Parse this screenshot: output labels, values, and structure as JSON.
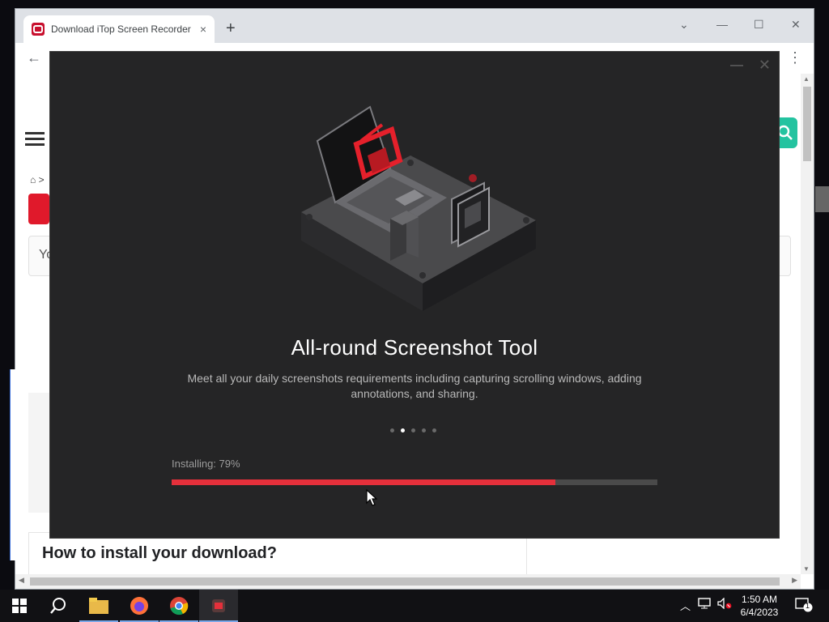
{
  "browser": {
    "tab_title": "Download iTop Screen Recorder",
    "tab_close": "×",
    "new_tab": "+",
    "back": "←",
    "menu": "⋮",
    "win_chevron": "⌄",
    "win_min": "—",
    "win_max": "☐",
    "win_close": "✕"
  },
  "page": {
    "search_icon": "🔍",
    "breadcrumb_home": "⌂ >",
    "input_stub": "Yo",
    "install_heading": "How to install your download?"
  },
  "installer": {
    "minimize": "—",
    "close": "✕",
    "feature_title": "All-round Screenshot Tool",
    "feature_desc": "Meet all your daily screenshots requirements including capturing scrolling windows, adding annotations, and sharing.",
    "carousel_count": 5,
    "carousel_active": 1,
    "progress_label": "Installing: 79%",
    "progress_value": 79,
    "accent_color": "#e5303b"
  },
  "taskbar": {
    "icons": [
      "windows-start-icon",
      "search-icon",
      "file-explorer-icon",
      "firefox-icon",
      "chrome-icon",
      "itop-installer-icon"
    ],
    "time": "1:50 AM",
    "date": "6/4/2023",
    "notification_count": "1"
  }
}
